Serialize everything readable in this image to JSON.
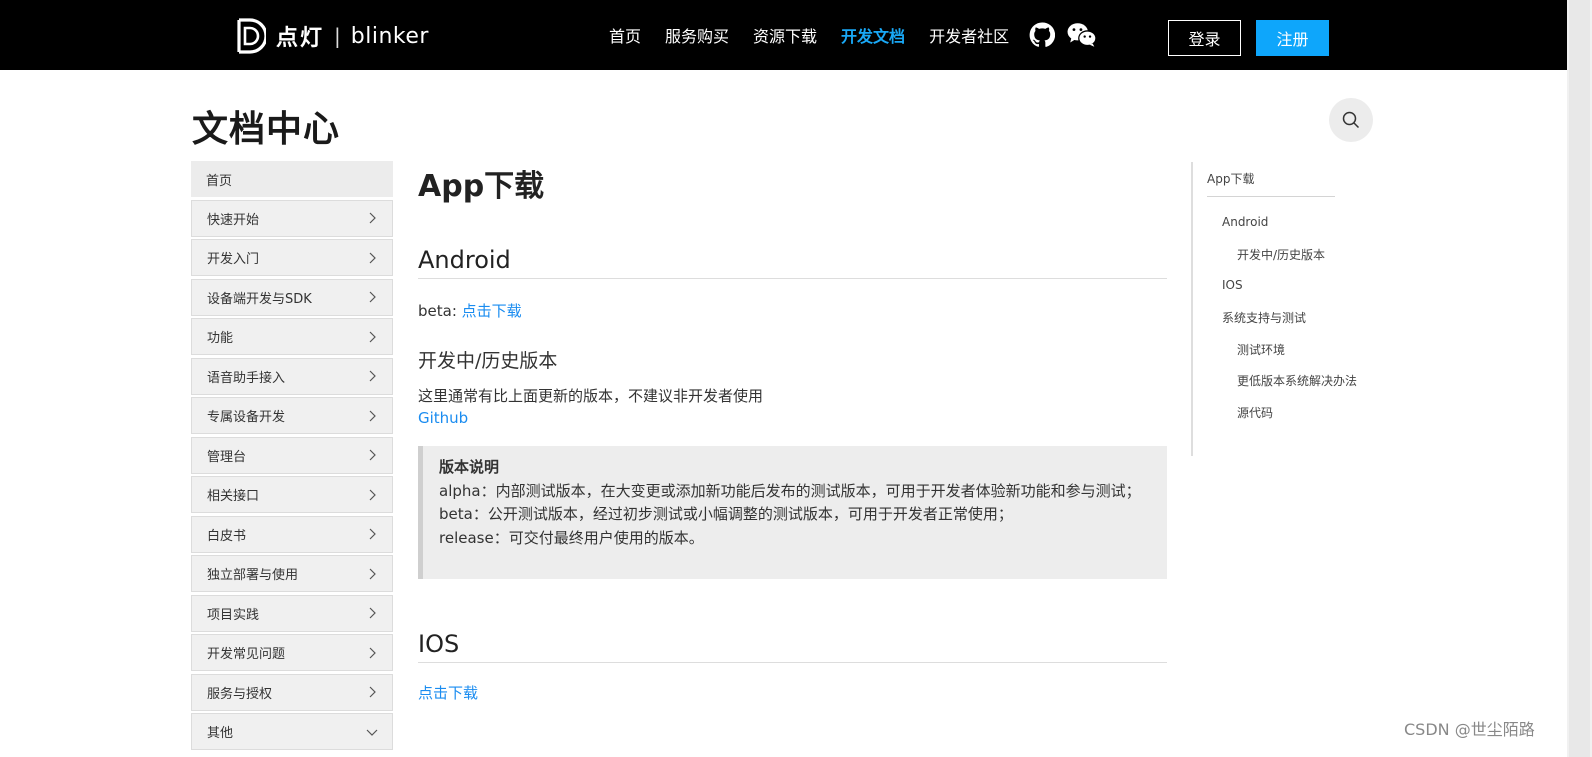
{
  "header": {
    "brand_cn": "点灯",
    "brand_sep": "|",
    "brand_en": "blinker",
    "nav": [
      "首页",
      "服务购买",
      "资源下载",
      "开发文档",
      "开发者社区"
    ],
    "active_nav": "开发文档",
    "login": "登录",
    "register": "注册",
    "icons": [
      "github-icon",
      "wechat-icon"
    ]
  },
  "page": {
    "title": "文档中心"
  },
  "sidebar": {
    "items": [
      {
        "label": "首页"
      },
      {
        "label": "快速开始"
      },
      {
        "label": "开发入门"
      },
      {
        "label": "设备端开发与SDK"
      },
      {
        "label": "功能"
      },
      {
        "label": "语音助手接入"
      },
      {
        "label": "专属设备开发"
      },
      {
        "label": "管理台"
      },
      {
        "label": "相关接口"
      },
      {
        "label": "白皮书"
      },
      {
        "label": "独立部署与使用"
      },
      {
        "label": "项目实践"
      },
      {
        "label": "开发常见问题"
      },
      {
        "label": "服务与授权"
      },
      {
        "label": "其他"
      }
    ]
  },
  "article": {
    "h1": "App下载",
    "android_heading": "Android",
    "beta_prefix": "beta: ",
    "beta_link": "点击下载",
    "dev_heading": "开发中/历史版本",
    "dev_note": "这里通常有比上面更新的版本，不建议非开发者使用",
    "github_link": "Github",
    "callout": {
      "title": "版本说明",
      "alpha": "alpha：内部测试版本，在大变更或添加新功能后发布的测试版本，可用于开发者体验新功能和参与测试；",
      "beta": "beta：公开测试版本，经过初步测试或小幅调整的测试版本，可用于开发者正常使用；",
      "release": "release：可交付最终用户使用的版本。"
    },
    "ios_heading": "IOS",
    "ios_link": "点击下载"
  },
  "toc": {
    "items": [
      "App下载",
      "Android",
      "开发中/历史版本",
      "IOS",
      "系统支持与测试",
      "测试环境",
      "更低版本系统解决办法",
      "源代码"
    ]
  },
  "watermark": "CSDN @世尘陌路",
  "colors": {
    "nav_bg": "#000000",
    "accent": "#19a8f6",
    "register_bg": "#0ea6fb",
    "link": "#1a8cf0"
  }
}
